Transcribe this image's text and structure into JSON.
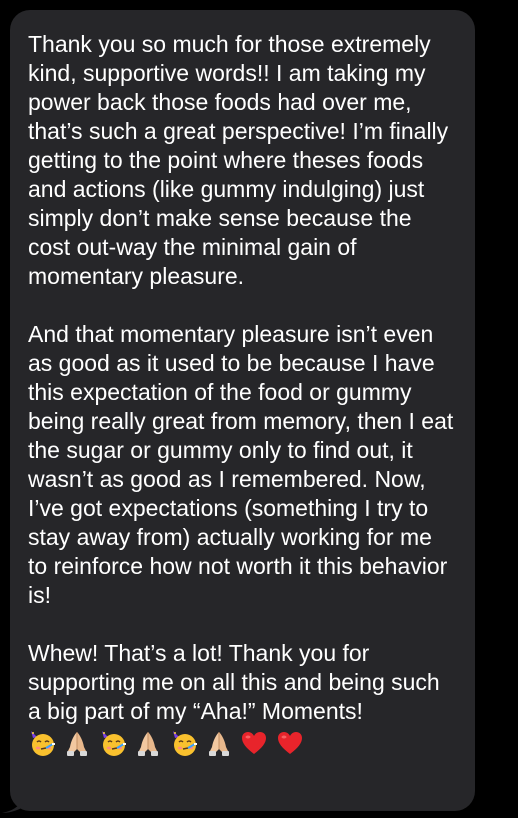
{
  "message": {
    "paragraphs": [
      "Thank you so much for those extremely kind, supportive words!! I am taking my power back those foods had over me, that’s such a great perspective! I’m finally getting to the point where theses foods and actions (like gummy indulging) just simply don’t make sense because the cost out-way the minimal gain of momentary pleasure.",
      "And that momentary pleasure isn’t even as good as it used to be because I have this expectation of the food or gummy being really great from memory, then I eat the sugar or gummy only to find out, it wasn’t as good as I remembered. Now, I’ve got expectations (something I try to stay away from) actually working for me to reinforce how not worth it this behavior is!",
      "Whew! That’s a lot! Thank you for supporting me on all this and being such a big part of my “Aha!” Moments!"
    ],
    "emojis": [
      "partying-face-emoji",
      "folded-hands-emoji",
      "partying-face-emoji",
      "folded-hands-emoji",
      "partying-face-emoji",
      "folded-hands-emoji",
      "red-heart-emoji",
      "red-heart-emoji"
    ],
    "bubble_color": "#262629",
    "text_color": "#ffffff"
  }
}
